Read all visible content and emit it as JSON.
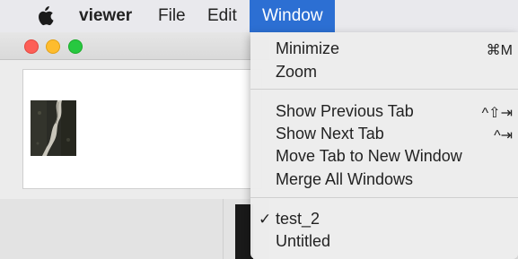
{
  "menubar": {
    "apple_icon": "apple-logo",
    "app_name": "viewer",
    "file": "File",
    "edit": "Edit",
    "window": "Window"
  },
  "window_menu": {
    "minimize": {
      "label": "Minimize",
      "shortcut": "⌘M"
    },
    "zoom": {
      "label": "Zoom"
    },
    "show_previous_tab": {
      "label": "Show Previous Tab",
      "shortcut": "^⇧⇥"
    },
    "show_next_tab": {
      "label": "Show Next Tab",
      "shortcut": "^⇥"
    },
    "move_tab": {
      "label": "Move Tab to New Window"
    },
    "merge_all": {
      "label": "Merge All Windows"
    },
    "windows": [
      {
        "label": "test_2",
        "checked": true,
        "check_mark": "✓"
      },
      {
        "label": "Untitled",
        "checked": false
      }
    ]
  },
  "colors": {
    "menu_highlight": "#2c6fd3",
    "close_light": "#fd5f57",
    "minimize_light": "#febc2e",
    "zoom_light": "#27c840"
  }
}
